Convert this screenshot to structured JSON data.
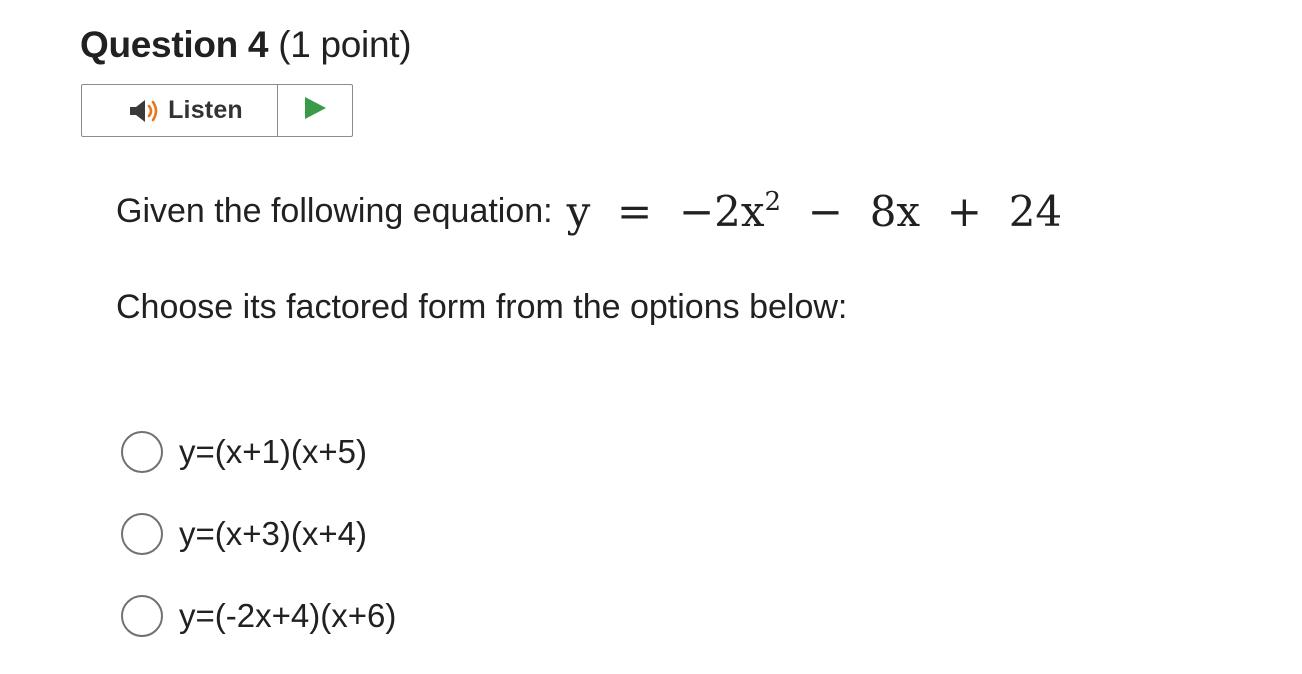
{
  "question": {
    "label": "Question 4",
    "points": "(1 point)"
  },
  "listen": {
    "label": "Listen",
    "speaker_icon": "speaker-icon",
    "play_icon": "play-icon",
    "speaker_wave_color": "#e8761f",
    "play_color": "#3a9a47"
  },
  "prompt": {
    "line1": "Given the following equation:",
    "equation_main": "y  =  −2x",
    "equation_exp": "2",
    "equation_tail": "  −  8x  +  24",
    "line2": "Choose its factored form from the options below:"
  },
  "options": [
    {
      "label": "y=(x+1)(x+5)"
    },
    {
      "label": "y=(x+3)(x+4)"
    },
    {
      "label": "y=(-2x+4)(x+6)"
    }
  ]
}
